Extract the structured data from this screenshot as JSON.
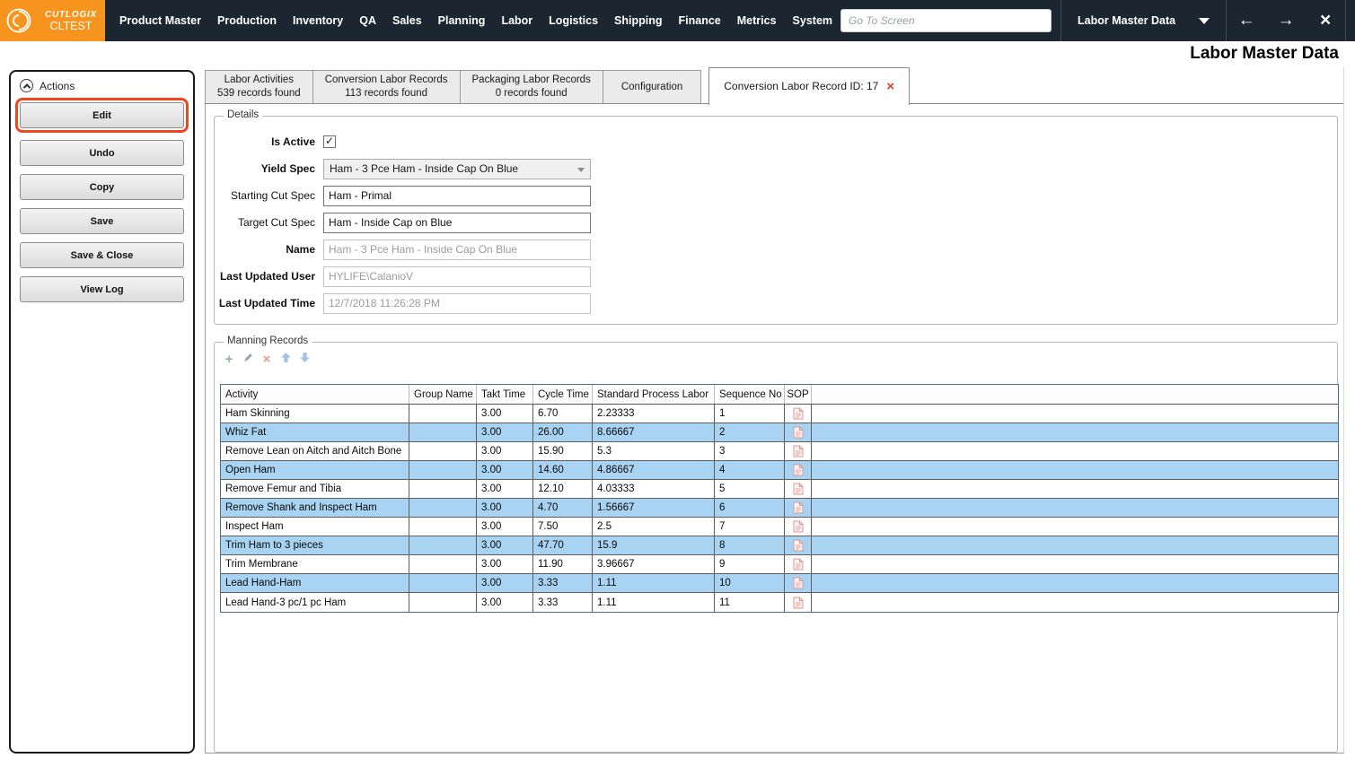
{
  "app": {
    "brand": "CUTLOGIX",
    "environment": "CLTEST",
    "page_title": "Labor Master Data"
  },
  "topbar": {
    "menu": [
      "Product Master",
      "Production",
      "Inventory",
      "QA",
      "Sales",
      "Planning",
      "Labor",
      "Logistics",
      "Shipping",
      "Finance",
      "Metrics",
      "System"
    ],
    "search_placeholder": "Go To Screen",
    "screen_selector": "Labor Master Data"
  },
  "icons": {
    "check": "✓",
    "tab_close": "×",
    "back": "←",
    "forward": "→",
    "close": "×",
    "star": "★",
    "add": "+",
    "delete": "×"
  },
  "colors": {
    "topbar_bg": "#1B2631",
    "brand_orange": "#F7941D",
    "highlight_orange": "#F2461F",
    "row_alt_blue": "#A8D3F2",
    "tab_close_red": "#E0382C"
  },
  "actions_panel": {
    "title": "Actions",
    "buttons": [
      "Edit",
      "Undo",
      "Copy",
      "Save",
      "Save & Close",
      "View Log"
    ]
  },
  "tabs": {
    "labor_activities": {
      "title": "Labor Activities",
      "subtitle": "539 records found"
    },
    "conversion_labor_records": {
      "title": "Conversion Labor Records",
      "subtitle": "113 records found"
    },
    "packaging_labor_records": {
      "title": "Packaging Labor Records",
      "subtitle": "0 records found"
    },
    "configuration": {
      "title": "Configuration"
    },
    "active_record": {
      "title": "Conversion Labor Record ID: 17"
    }
  },
  "details": {
    "legend": "Details",
    "is_active": {
      "label": "Is Active",
      "checked": true
    },
    "yield_spec": {
      "label": "Yield Spec",
      "value": "Ham - 3 Pce Ham - Inside Cap On Blue"
    },
    "starting_cut_spec": {
      "label": "Starting Cut Spec",
      "value": "Ham - Primal"
    },
    "target_cut_spec": {
      "label": "Target Cut Spec",
      "value": "Ham - Inside Cap on Blue"
    },
    "name": {
      "label": "Name",
      "value": "Ham - 3 Pce Ham - Inside Cap On Blue"
    },
    "last_updated_user": {
      "label": "Last Updated User",
      "value": "HYLIFE\\CalanioV"
    },
    "last_updated_time": {
      "label": "Last Updated Time",
      "value": "12/7/2018 11:26:28 PM"
    }
  },
  "manning": {
    "legend": "Manning Records",
    "columns": [
      "Activity",
      "Group Name",
      "Takt Time",
      "Cycle Time",
      "Standard Process Labor",
      "Sequence No",
      "SOP"
    ],
    "rows": [
      {
        "activity": "Ham Skinning",
        "group_name": "",
        "takt_time": "3.00",
        "cycle_time": "6.70",
        "standard_process_labor": "2.23333",
        "sequence_no": "1"
      },
      {
        "activity": "Whiz Fat",
        "group_name": "",
        "takt_time": "3.00",
        "cycle_time": "26.00",
        "standard_process_labor": "8.66667",
        "sequence_no": "2"
      },
      {
        "activity": "Remove Lean on Aitch and Aitch Bone",
        "group_name": "",
        "takt_time": "3.00",
        "cycle_time": "15.90",
        "standard_process_labor": "5.3",
        "sequence_no": "3"
      },
      {
        "activity": "Open Ham",
        "group_name": "",
        "takt_time": "3.00",
        "cycle_time": "14.60",
        "standard_process_labor": "4.86667",
        "sequence_no": "4"
      },
      {
        "activity": "Remove Femur and Tibia",
        "group_name": "",
        "takt_time": "3.00",
        "cycle_time": "12.10",
        "standard_process_labor": "4.03333",
        "sequence_no": "5"
      },
      {
        "activity": "Remove Shank and Inspect Ham",
        "group_name": "",
        "takt_time": "3.00",
        "cycle_time": "4.70",
        "standard_process_labor": "1.56667",
        "sequence_no": "6"
      },
      {
        "activity": "Inspect Ham",
        "group_name": "",
        "takt_time": "3.00",
        "cycle_time": "7.50",
        "standard_process_labor": "2.5",
        "sequence_no": "7"
      },
      {
        "activity": "Trim Ham to 3 pieces",
        "group_name": "",
        "takt_time": "3.00",
        "cycle_time": "47.70",
        "standard_process_labor": "15.9",
        "sequence_no": "8"
      },
      {
        "activity": "Trim Membrane",
        "group_name": "",
        "takt_time": "3.00",
        "cycle_time": "11.90",
        "standard_process_labor": "3.96667",
        "sequence_no": "9"
      },
      {
        "activity": "Lead Hand-Ham",
        "group_name": "",
        "takt_time": "3.00",
        "cycle_time": "3.33",
        "standard_process_labor": "1.11",
        "sequence_no": "10"
      },
      {
        "activity": "Lead Hand-3 pc/1 pc Ham",
        "group_name": "",
        "takt_time": "3.00",
        "cycle_time": "3.33",
        "standard_process_labor": "1.11",
        "sequence_no": "11"
      }
    ]
  }
}
